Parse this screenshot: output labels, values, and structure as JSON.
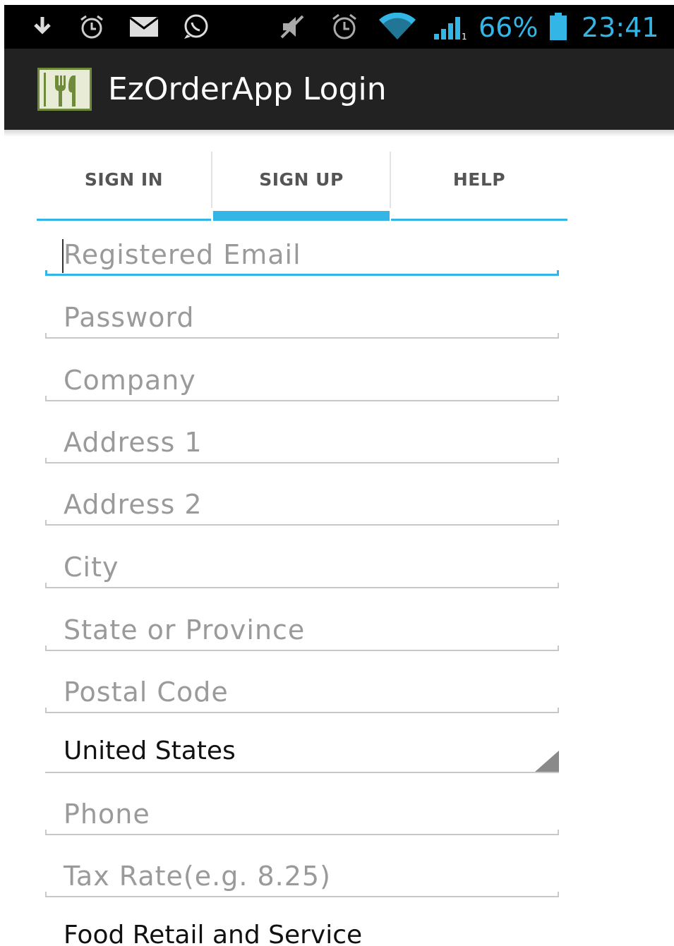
{
  "status_bar": {
    "icons": [
      "download-icon",
      "alarm-icon",
      "mail-icon",
      "whatsapp-icon",
      "mute-icon",
      "alarm-icon",
      "wifi-icon",
      "signal-icon"
    ],
    "battery_percent": "66%",
    "time": "23:41"
  },
  "action_bar": {
    "title": "EzOrderApp Login",
    "logo_icon": "restaurant-icon"
  },
  "tabs": [
    {
      "label": "SIGN IN",
      "active": false
    },
    {
      "label": "SIGN UP",
      "active": true
    },
    {
      "label": "HELP",
      "active": false
    }
  ],
  "form": {
    "email_placeholder": "Registered Email",
    "password_placeholder": "Password",
    "company_placeholder": "Company",
    "address1_placeholder": "Address 1",
    "address2_placeholder": "Address 2",
    "city_placeholder": "City",
    "state_placeholder": "State or Province",
    "postal_placeholder": "Postal Code",
    "country_selected": "United States",
    "phone_placeholder": "Phone",
    "tax_placeholder": "Tax Rate(e.g. 8.25)",
    "business_type_selected": "Food Retail and Service"
  },
  "colors": {
    "accent": "#33b5e5",
    "action_bar": "#222222",
    "status_bar": "#000000"
  }
}
